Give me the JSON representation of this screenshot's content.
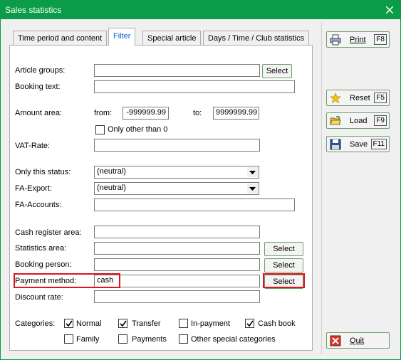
{
  "window": {
    "title": "Sales statistics"
  },
  "tabs": [
    "Time period and content",
    "Filter",
    "Special article",
    "Days / Time / Club statistics"
  ],
  "filter": {
    "article_groups": {
      "label": "Article groups:",
      "value": "",
      "button": "Select"
    },
    "booking_text": {
      "label": "Booking text:",
      "value": ""
    },
    "amount_area": {
      "label": "Amount area:",
      "from_label": "from:",
      "from_value": "-999999.99",
      "to_label": "to:",
      "to_value": "9999999.99",
      "only_other": {
        "label": "Only other than 0",
        "checked": false
      }
    },
    "vat_rate": {
      "label": "VAT-Rate:",
      "value": ""
    },
    "only_this_status": {
      "label": "Only this status:",
      "value": "(neutral)"
    },
    "fa_export": {
      "label": "FA-Export:",
      "value": "(neutral)"
    },
    "fa_accounts": {
      "label": "FA-Accounts:",
      "value": ""
    },
    "cash_register_area": {
      "label": "Cash register area:",
      "value": ""
    },
    "statistics_area": {
      "label": "Statistics area:",
      "value": "",
      "button": "Select"
    },
    "booking_person": {
      "label": "Booking person:",
      "value": "",
      "button": "Select"
    },
    "payment_method": {
      "label": "Payment method:",
      "value": "cash",
      "button": "Select"
    },
    "discount_rate": {
      "label": "Discount rate:",
      "value": ""
    },
    "categories": {
      "label": "Categories:",
      "items": [
        {
          "label": "Normal",
          "checked": true
        },
        {
          "label": "Transfer",
          "checked": true
        },
        {
          "label": "In-payment",
          "checked": false
        },
        {
          "label": "Cash book",
          "checked": true
        },
        {
          "label": "Family",
          "checked": false
        },
        {
          "label": "Payments",
          "checked": false
        },
        {
          "label": "Other special categories",
          "checked": false
        }
      ]
    }
  },
  "side_buttons": {
    "print": {
      "label": "Print",
      "key": "F8"
    },
    "reset": {
      "label": "Reset",
      "key": "F5"
    },
    "load": {
      "label": "Load",
      "key": "F9"
    },
    "save": {
      "label": "Save",
      "key": "F11"
    },
    "quit": {
      "label": "Quit"
    }
  },
  "colors": {
    "title_bar": "#0a9c46",
    "highlight": "#e0141c",
    "active_tab_text": "#0066cc"
  }
}
